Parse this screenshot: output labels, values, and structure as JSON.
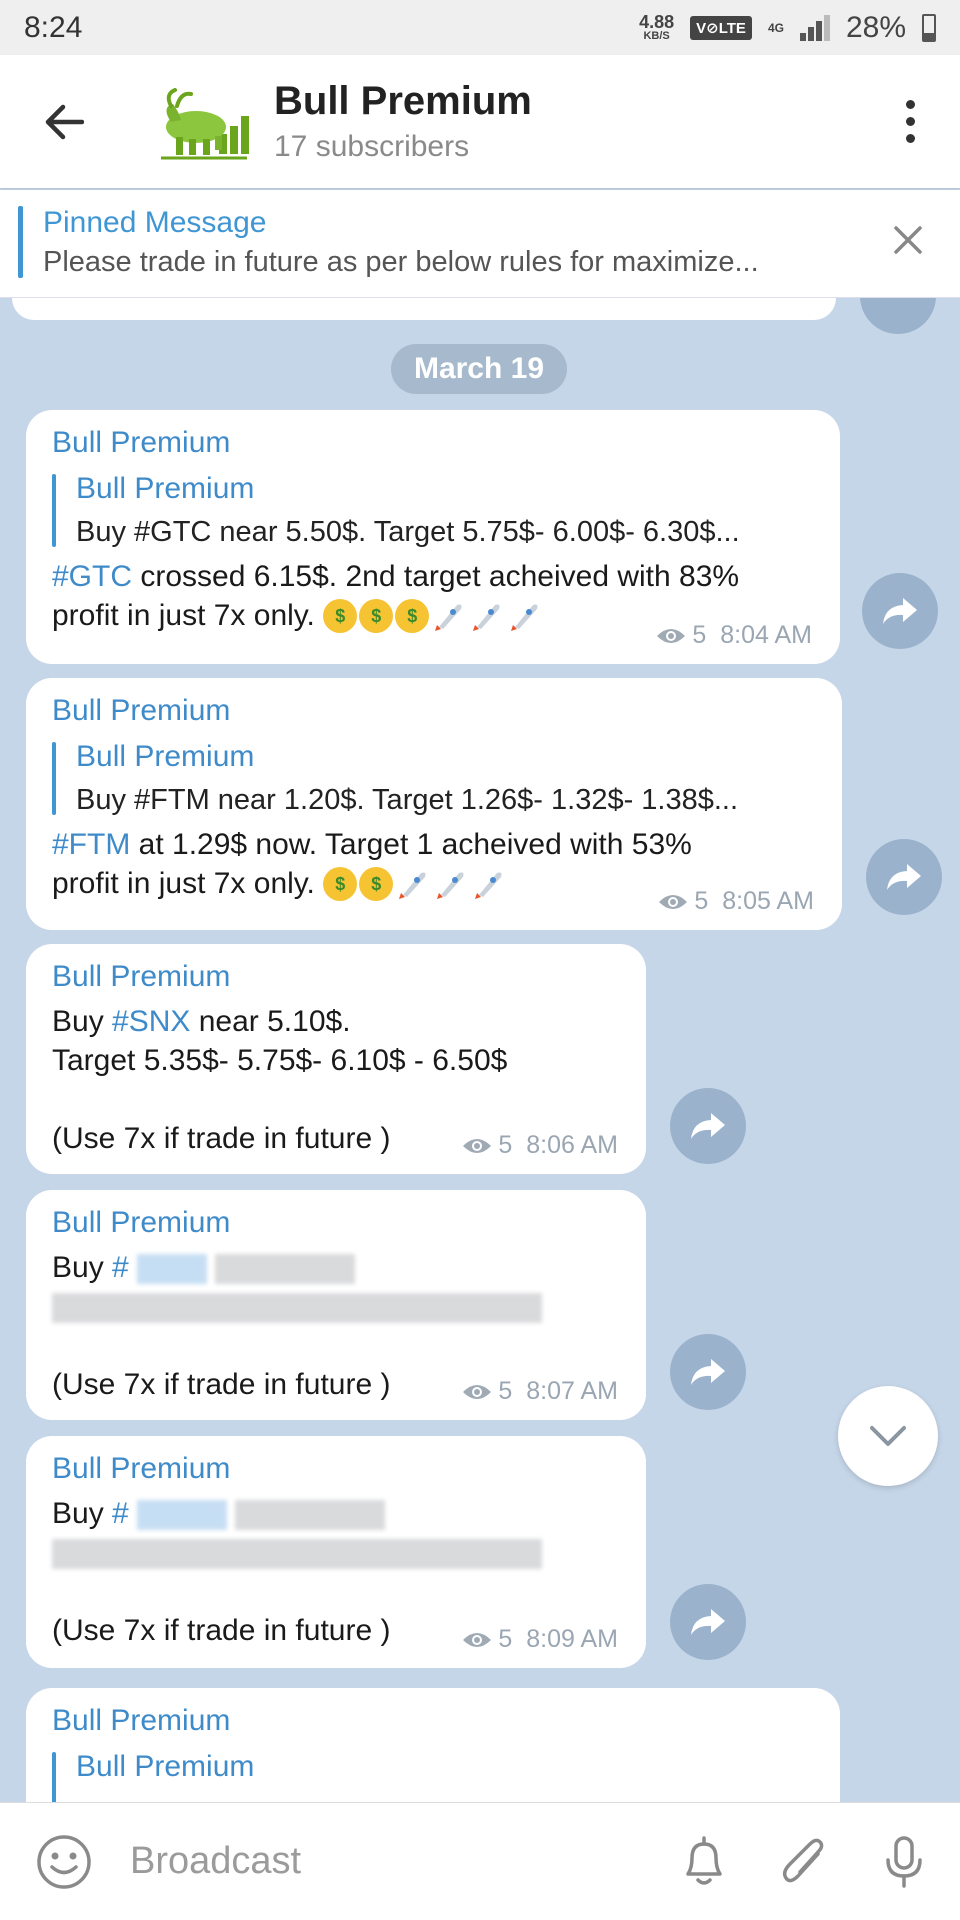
{
  "status_bar": {
    "time": "8:24",
    "net_speed_value": "4.88",
    "net_speed_unit": "KB/S",
    "volte_label": "V⊘LTE",
    "network_label": "4G",
    "battery": "28%"
  },
  "header": {
    "title": "Bull Premium",
    "subtitle": "17 subscribers",
    "back_icon": "arrow-left-icon",
    "menu_icon": "more-vertical-icon"
  },
  "pinned": {
    "title": "Pinned Message",
    "text": "Please trade in future as per below rules for maximize..."
  },
  "chat": {
    "date_label": "March 19",
    "messages": [
      {
        "sender": "Bull Premium",
        "reply_name": "Bull Premium",
        "reply_text": "Buy #GTC near 5.50$.  Target 5.75$- 6.00$- 6.30$...",
        "tag": "#GTC",
        "line1_rest": " crossed 6.15$. 2nd target acheived with 83%",
        "line2": "profit in just 7x only. ",
        "views": "5",
        "time": "8:04 AM"
      },
      {
        "sender": "Bull Premium",
        "reply_name": "Bull Premium",
        "reply_text": "Buy #FTM near 1.20$.  Target 1.26$- 1.32$- 1.38$...",
        "tag": "#FTM",
        "line1_rest": " at 1.29$ now. Target 1 acheived with 53%",
        "line2": "profit in just 7x only. ",
        "views": "5",
        "time": "8:05 AM"
      },
      {
        "sender": "Bull Premium",
        "line1_pre": "Buy ",
        "tag": "#SNX",
        "line1_rest": " near 5.10$.",
        "line2": "Target 5.35$- 5.75$- 6.10$ - 6.50$",
        "line3": "(Use 7x if trade in future )",
        "views": "5",
        "time": "8:06 AM"
      },
      {
        "sender": "Bull Premium",
        "line1_pre": "Buy ",
        "tag": "#",
        "line3": "(Use 7x if trade in future )",
        "views": "5",
        "time": "8:07 AM"
      },
      {
        "sender": "Bull Premium",
        "line1_pre": "Buy ",
        "tag": "#",
        "line3": "(Use 7x if trade in future )",
        "views": "5",
        "time": "8:09 AM"
      },
      {
        "sender": "Bull Premium",
        "reply_name": "Bull Premium"
      }
    ]
  },
  "input_bar": {
    "placeholder": "Broadcast",
    "icons": [
      "emoji-icon",
      "bell-icon",
      "paperclip-icon",
      "microphone-icon"
    ]
  },
  "colors": {
    "accent": "#3f8bc9",
    "chat_background": "#c5d6e8",
    "bubble": "#ffffff"
  }
}
